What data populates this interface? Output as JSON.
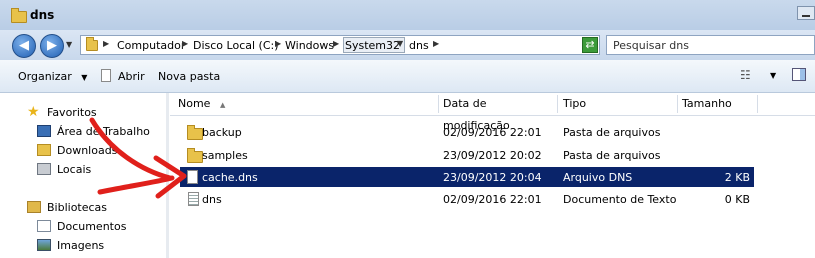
{
  "window": {
    "title": "dns"
  },
  "address": {
    "crumbs": [
      "Computador",
      "Disco Local (C:)",
      "Windows",
      "System32",
      "dns"
    ],
    "search_placeholder": "Pesquisar dns"
  },
  "toolbar": {
    "organize": "Organizar",
    "open": "Abrir",
    "new_folder": "Nova pasta"
  },
  "sidebar": {
    "favorites": "Favoritos",
    "fav_items": [
      "Área de Trabalho",
      "Downloads",
      "Locais"
    ],
    "libraries": "Bibliotecas",
    "lib_items": [
      "Documentos",
      "Imagens"
    ]
  },
  "columns": {
    "name": "Nome",
    "date": "Data de modificação",
    "type": "Tipo",
    "size": "Tamanho"
  },
  "files": [
    {
      "name": "backup",
      "date": "02/09/2016 22:01",
      "type": "Pasta de arquivos",
      "size": "",
      "icon": "folder-icon"
    },
    {
      "name": "samples",
      "date": "23/09/2012 20:02",
      "type": "Pasta de arquivos",
      "size": "",
      "icon": "folder-icon"
    },
    {
      "name": "cache.dns",
      "date": "23/09/2012 20:04",
      "type": "Arquivo DNS",
      "size": "2 KB",
      "icon": "file-icon",
      "selected": true
    },
    {
      "name": "dns",
      "date": "02/09/2016 22:01",
      "type": "Documento de Texto",
      "size": "0 KB",
      "icon": "text-file-icon"
    }
  ],
  "colors": {
    "selection": "#0a246a",
    "annotation_arrow": "#e0201b"
  }
}
